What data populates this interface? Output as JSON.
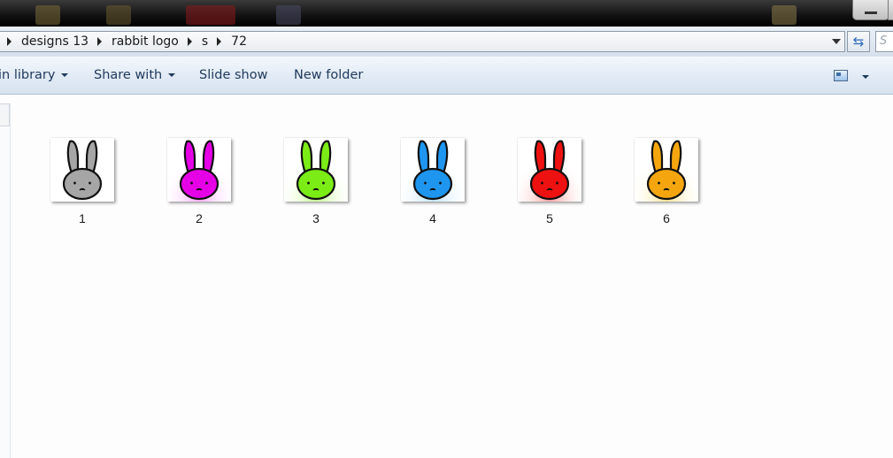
{
  "window": {
    "breadcrumb": [
      "designs 13",
      "rabbit logo",
      "s",
      "72"
    ],
    "search_placeholder": "S"
  },
  "toolbar": {
    "items": [
      {
        "label": "in library",
        "has_dropdown": true
      },
      {
        "label": "Share with",
        "has_dropdown": true
      },
      {
        "label": "Slide show",
        "has_dropdown": false
      },
      {
        "label": "New folder",
        "has_dropdown": false
      }
    ],
    "view_icon": "change-view-icon"
  },
  "files": [
    {
      "name": "1",
      "color": "#a6a6a6",
      "accent": "none"
    },
    {
      "name": "2",
      "color": "#e600e6",
      "accent": "#ff66ff"
    },
    {
      "name": "3",
      "color": "#7cec16",
      "accent": "#9cff3c"
    },
    {
      "name": "4",
      "color": "#1e96f0",
      "accent": "#8fd0ff"
    },
    {
      "name": "5",
      "color": "#ee1111",
      "accent": "#ff5050"
    },
    {
      "name": "6",
      "color": "#f5a60f",
      "accent": "#ffd040"
    }
  ]
}
